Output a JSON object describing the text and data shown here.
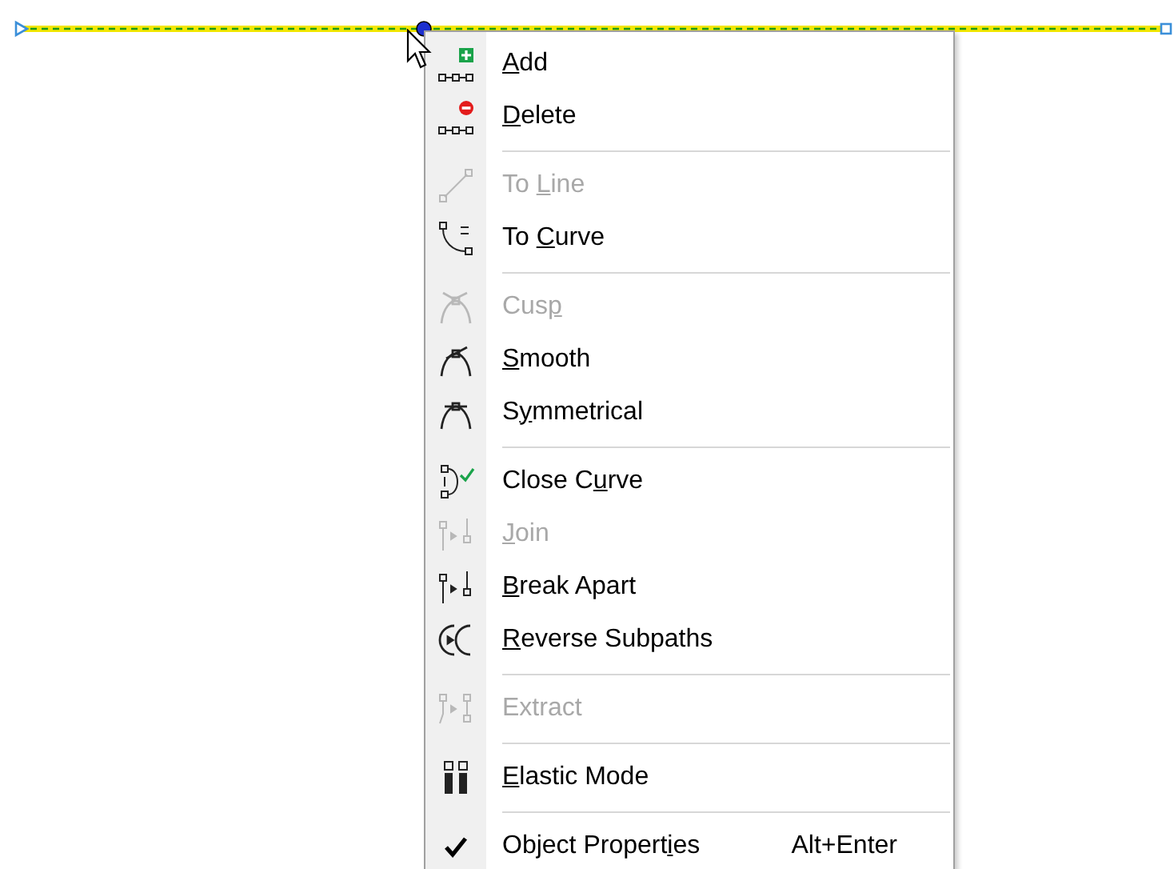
{
  "menu": {
    "items": [
      {
        "kind": "item",
        "key": "A",
        "after_key": "dd",
        "disabled": false,
        "checked": false
      },
      {
        "kind": "item",
        "key": "D",
        "after_key": "elete",
        "disabled": false,
        "checked": false
      },
      {
        "kind": "separator"
      },
      {
        "kind": "item",
        "before_key": "To ",
        "key": "L",
        "after_key": "ine",
        "disabled": true,
        "checked": false
      },
      {
        "kind": "item",
        "before_key": "To ",
        "key": "C",
        "after_key": "urve",
        "disabled": false,
        "checked": false
      },
      {
        "kind": "separator"
      },
      {
        "kind": "item",
        "before_key": "Cus",
        "key": "p",
        "disabled": true,
        "checked": false
      },
      {
        "kind": "item",
        "key": "S",
        "after_key": "mooth",
        "disabled": false,
        "checked": false
      },
      {
        "kind": "item",
        "before_key": "S",
        "key": "y",
        "after_key": "mmetrical",
        "disabled": false,
        "checked": false
      },
      {
        "kind": "separator"
      },
      {
        "kind": "item",
        "before_key": "Close C",
        "key": "u",
        "after_key": "rve",
        "disabled": false,
        "checked": false
      },
      {
        "kind": "item",
        "key": "J",
        "after_key": "oin",
        "disabled": true,
        "checked": false
      },
      {
        "kind": "item",
        "key": "B",
        "after_key": "reak Apart",
        "disabled": false,
        "checked": false
      },
      {
        "kind": "item",
        "key": "R",
        "after_key": "everse Subpaths",
        "disabled": false,
        "checked": false
      },
      {
        "kind": "separator"
      },
      {
        "kind": "item",
        "before_key": "Extract",
        "disabled": true,
        "checked": false
      },
      {
        "kind": "separator"
      },
      {
        "kind": "item",
        "key": "E",
        "after_key": "lastic Mode",
        "disabled": false,
        "checked": false
      },
      {
        "kind": "separator"
      },
      {
        "kind": "item",
        "before_key": "Object Propert",
        "key": "i",
        "after_key": "es",
        "shortcut": "Alt+Enter",
        "disabled": false,
        "checked": true
      }
    ]
  }
}
